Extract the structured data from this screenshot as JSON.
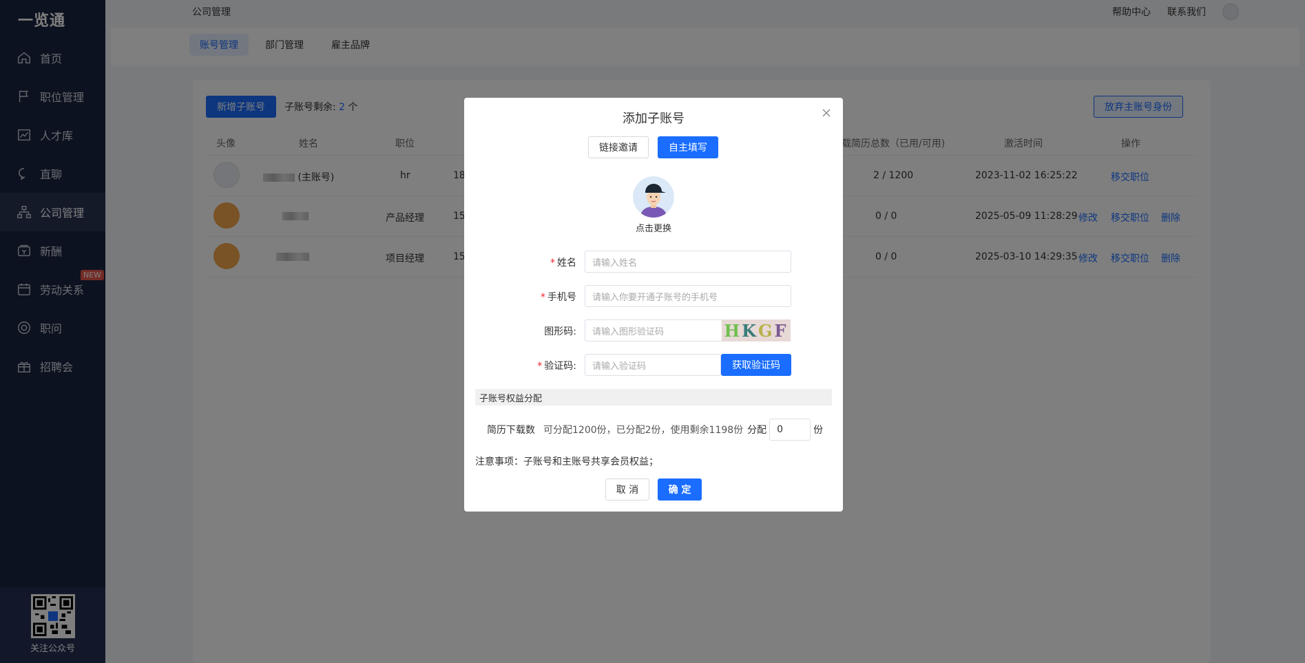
{
  "sidebar": {
    "logo": "一览通",
    "items": [
      {
        "label": "首页",
        "icon": "home-icon"
      },
      {
        "label": "职位管理",
        "icon": "flag-icon"
      },
      {
        "label": "人才库",
        "icon": "chart-line-icon"
      },
      {
        "label": "直聊",
        "icon": "chat-icon"
      },
      {
        "label": "公司管理",
        "icon": "org-icon"
      },
      {
        "label": "新酬",
        "icon": "wallet-icon"
      },
      {
        "label": "劳动关系",
        "icon": "calendar-icon",
        "badge": "NEW"
      },
      {
        "label": "职问",
        "icon": "target-icon"
      },
      {
        "label": "招聘会",
        "icon": "gift-icon"
      }
    ],
    "qr_label": "关注公众号"
  },
  "topbar": {
    "title": "公司管理",
    "help": "帮助中心",
    "contact": "联系我们"
  },
  "tabs": [
    {
      "label": "账号管理",
      "active": true
    },
    {
      "label": "部门管理",
      "active": false
    },
    {
      "label": "雇主品牌",
      "active": false
    }
  ],
  "main": {
    "add_button": "新增子账号",
    "remain_label": "子账号剩余:",
    "remain_count": "2",
    "remain_unit": "个",
    "abandon_button": "放弃主账号身份",
    "columns": {
      "avatar": "头像",
      "name": "姓名",
      "position": "职位",
      "download": "载简历总数（已用/可用)",
      "activated": "激活时间",
      "actions": "操作"
    },
    "rows": [
      {
        "name_suffix": "(主账号)",
        "position": "hr",
        "phone_prefix": "18",
        "download": "2 / 1200",
        "activated": "2023-11-02 16:25:22",
        "actions": [
          "移交职位"
        ]
      },
      {
        "name_suffix": "",
        "position": "产品经理",
        "phone_prefix": "15",
        "download": "0 / 0",
        "activated": "2025-05-09 11:28:29",
        "actions": [
          "修改",
          "移交职位",
          "删除"
        ]
      },
      {
        "name_suffix": "",
        "position": "项目经理",
        "phone_prefix": "15",
        "download": "0 / 0",
        "activated": "2025-03-10 14:29:35",
        "actions": [
          "修改",
          "移交职位",
          "删除"
        ]
      }
    ]
  },
  "modal": {
    "title": "添加子账号",
    "mode_link": "链接邀请",
    "mode_self": "自主填写",
    "avatar_label": "点击更换",
    "fields": {
      "name_label": "姓名",
      "name_placeholder": "请输入姓名",
      "phone_label": "手机号",
      "phone_placeholder": "请输入你要开通子账号的手机号",
      "captcha_label": "图形码:",
      "captcha_placeholder": "请输入图形验证码",
      "captcha_text": "HKGF",
      "code_label": "验证码:",
      "code_placeholder": "请输入验证码",
      "get_code": "获取验证码"
    },
    "section_title": "子账号权益分配",
    "alloc": {
      "label": "简历下载数",
      "desc": "可分配1200份，已分配2份，使用剩余1198份",
      "assign_label": "分配",
      "value": "0",
      "unit": "份"
    },
    "note": "注意事项：子账号和主账号共享会员权益；",
    "cancel": "取 消",
    "confirm": "确 定"
  },
  "colors": {
    "primary": "#1a6dff",
    "sidebar_bg": "#1b2440",
    "required": "#f5222d"
  }
}
